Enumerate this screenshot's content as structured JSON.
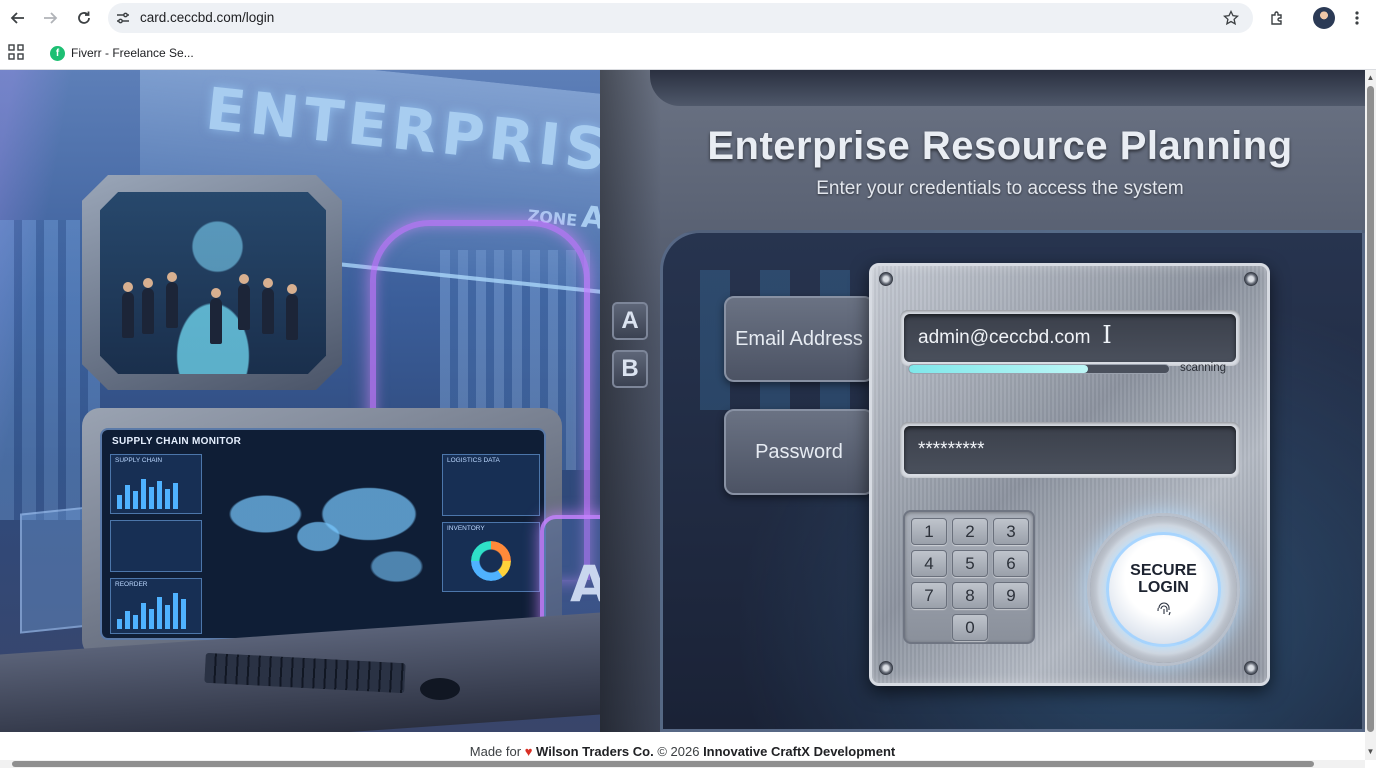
{
  "browser": {
    "url": "card.ceccbd.com/login",
    "bookmarks": [
      {
        "label": "Fiverr - Freelance Se..."
      }
    ],
    "icons": {
      "back": "back-arrow-icon",
      "forward": "forward-arrow-icon",
      "reload": "reload-icon",
      "site_info": "tune-icon",
      "bookmark_star": "star-icon",
      "extensions": "puzzle-icon",
      "menu": "more-vert-icon",
      "apps": "apps-grid-icon"
    }
  },
  "scene": {
    "sign_text": "ENTERPRISE",
    "zone_label": "ZONE",
    "zone_letter": "A",
    "monitor_title": "SUPPLY CHAIN MONITOR",
    "panel_labels": [
      "SUPPLY CHAIN",
      "LOGISTICS DATA",
      "INVENTORY",
      "REORDER"
    ],
    "lab_sign": "AB",
    "tags": [
      "A",
      "B"
    ]
  },
  "login": {
    "title": "Enterprise Resource Planning",
    "subtitle": "Enter your credentials to access the system",
    "email_label": "Email Address",
    "email_value": "admin@ceccbd.com",
    "password_label": "Password",
    "password_value": "*********",
    "scan_status": "scanning",
    "scan_progress": 0.69,
    "keypad": [
      "1",
      "2",
      "3",
      "4",
      "5",
      "6",
      "7",
      "8",
      "9",
      "0"
    ],
    "button_label": "SECURE LOGIN",
    "accent_color": "#7fe7ea"
  },
  "footer": {
    "prefix": "Made for",
    "company": "Wilson Traders Co.",
    "copyright": "© 2026",
    "developer": "Innovative CraftX Development"
  }
}
